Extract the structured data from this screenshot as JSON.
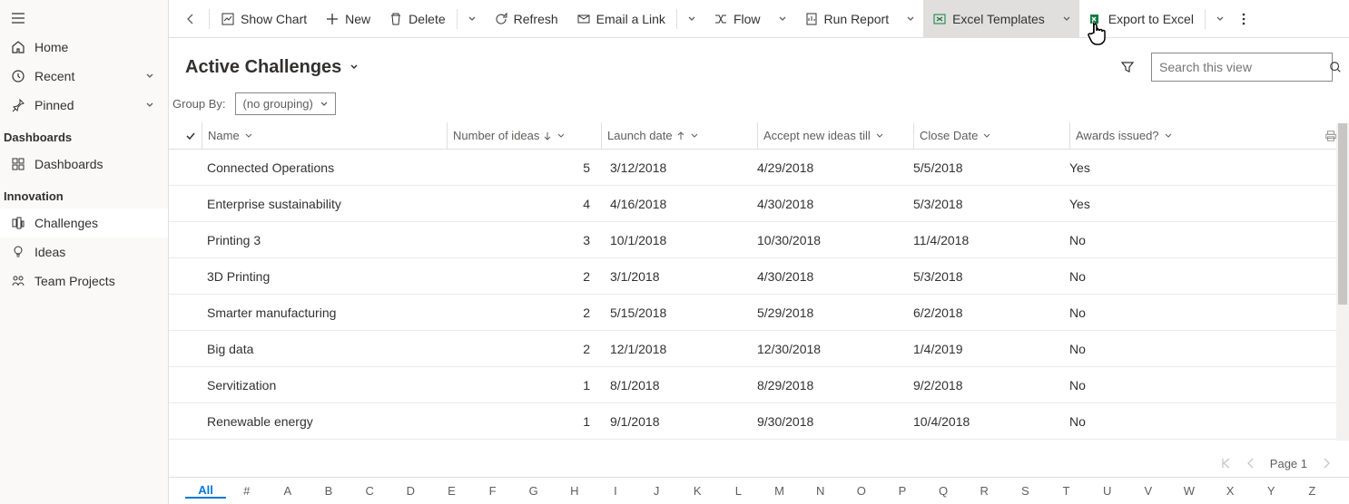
{
  "sidebar": {
    "home": "Home",
    "recent": "Recent",
    "pinned": "Pinned",
    "section_dashboards": "Dashboards",
    "dashboards": "Dashboards",
    "section_innovation": "Innovation",
    "challenges": "Challenges",
    "ideas": "Ideas",
    "team_projects": "Team Projects"
  },
  "commands": {
    "show_chart": "Show Chart",
    "new": "New",
    "delete": "Delete",
    "refresh": "Refresh",
    "email": "Email a Link",
    "flow": "Flow",
    "run_report": "Run Report",
    "excel_templates": "Excel Templates",
    "export_excel": "Export to Excel"
  },
  "view": {
    "title": "Active Challenges",
    "groupby_label": "Group By:",
    "groupby_value": "(no grouping)",
    "search_placeholder": "Search this view"
  },
  "columns": {
    "name": "Name",
    "num": "Number of ideas",
    "launch": "Launch date",
    "accept": "Accept new ideas till",
    "close": "Close Date",
    "awards": "Awards issued?"
  },
  "rows": [
    {
      "name": "Connected Operations",
      "num": "5",
      "launch": "3/12/2018",
      "accept": "4/29/2018",
      "close": "5/5/2018",
      "awards": "Yes"
    },
    {
      "name": "Enterprise sustainability",
      "num": "4",
      "launch": "4/16/2018",
      "accept": "4/30/2018",
      "close": "5/3/2018",
      "awards": "Yes"
    },
    {
      "name": "Printing 3",
      "num": "3",
      "launch": "10/1/2018",
      "accept": "10/30/2018",
      "close": "11/4/2018",
      "awards": "No"
    },
    {
      "name": "3D Printing",
      "num": "2",
      "launch": "3/1/2018",
      "accept": "4/30/2018",
      "close": "5/3/2018",
      "awards": "No"
    },
    {
      "name": "Smarter manufacturing",
      "num": "2",
      "launch": "5/15/2018",
      "accept": "5/29/2018",
      "close": "6/2/2018",
      "awards": "No"
    },
    {
      "name": "Big data",
      "num": "2",
      "launch": "12/1/2018",
      "accept": "12/30/2018",
      "close": "1/4/2019",
      "awards": "No"
    },
    {
      "name": "Servitization",
      "num": "1",
      "launch": "8/1/2018",
      "accept": "8/29/2018",
      "close": "9/2/2018",
      "awards": "No"
    },
    {
      "name": "Renewable energy",
      "num": "1",
      "launch": "9/1/2018",
      "accept": "9/30/2018",
      "close": "10/4/2018",
      "awards": "No"
    }
  ],
  "pager": {
    "page": "Page 1"
  },
  "alpha": [
    "All",
    "#",
    "A",
    "B",
    "C",
    "D",
    "E",
    "F",
    "G",
    "H",
    "I",
    "J",
    "K",
    "L",
    "M",
    "N",
    "O",
    "P",
    "Q",
    "R",
    "S",
    "T",
    "U",
    "V",
    "W",
    "X",
    "Y",
    "Z"
  ]
}
